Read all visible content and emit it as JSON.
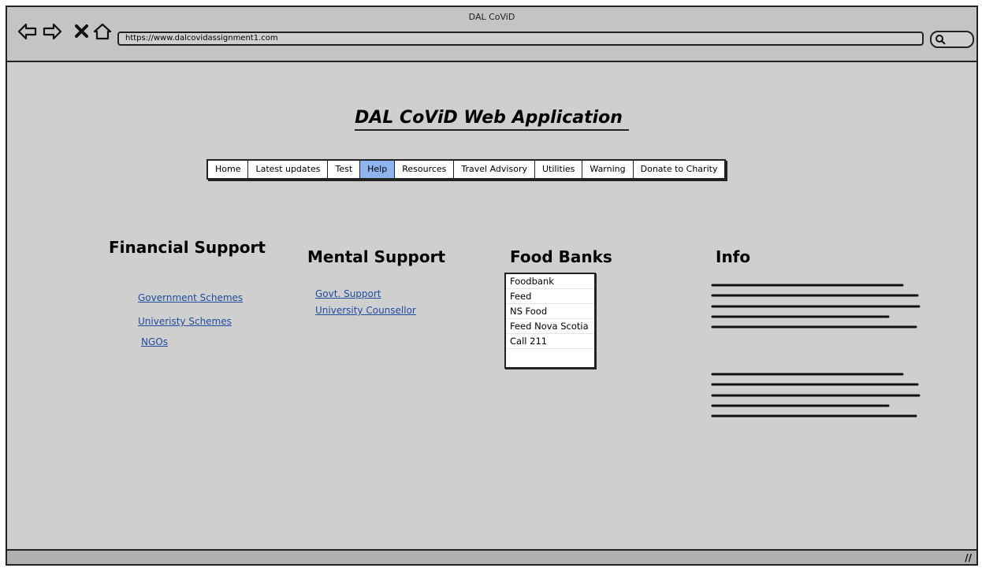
{
  "window": {
    "title": "DAL CoViD"
  },
  "browser": {
    "url": "https://www.dalcovidassignment1.com",
    "icons": [
      "back-arrow-icon",
      "forward-arrow-icon",
      "close-x-icon",
      "home-icon",
      "search-icon"
    ]
  },
  "page": {
    "title": "DAL CoViD Web Application"
  },
  "menu": {
    "items": [
      "Home",
      "Latest updates",
      "Test",
      "Help",
      "Resources",
      "Travel Advisory",
      "Utilities",
      "Warning",
      "Donate to Charity"
    ],
    "active": "Help"
  },
  "financial": {
    "heading": "Financial Support",
    "links": [
      "Government Schemes",
      "Univeristy Schemes",
      "NGOs"
    ]
  },
  "mental": {
    "heading": "Mental Support",
    "links": [
      "Govt. Support",
      "University Counsellor"
    ]
  },
  "food": {
    "heading": "Food Banks",
    "list": [
      "Foodbank",
      "Feed",
      "NS Food",
      "Feed Nova Scotia",
      "Call 211"
    ]
  },
  "info": {
    "heading": "Info"
  },
  "colors": {
    "active_tab": "#8fb4f0",
    "link": "#1f4c9e",
    "page_bg": "#cfcfcf"
  }
}
